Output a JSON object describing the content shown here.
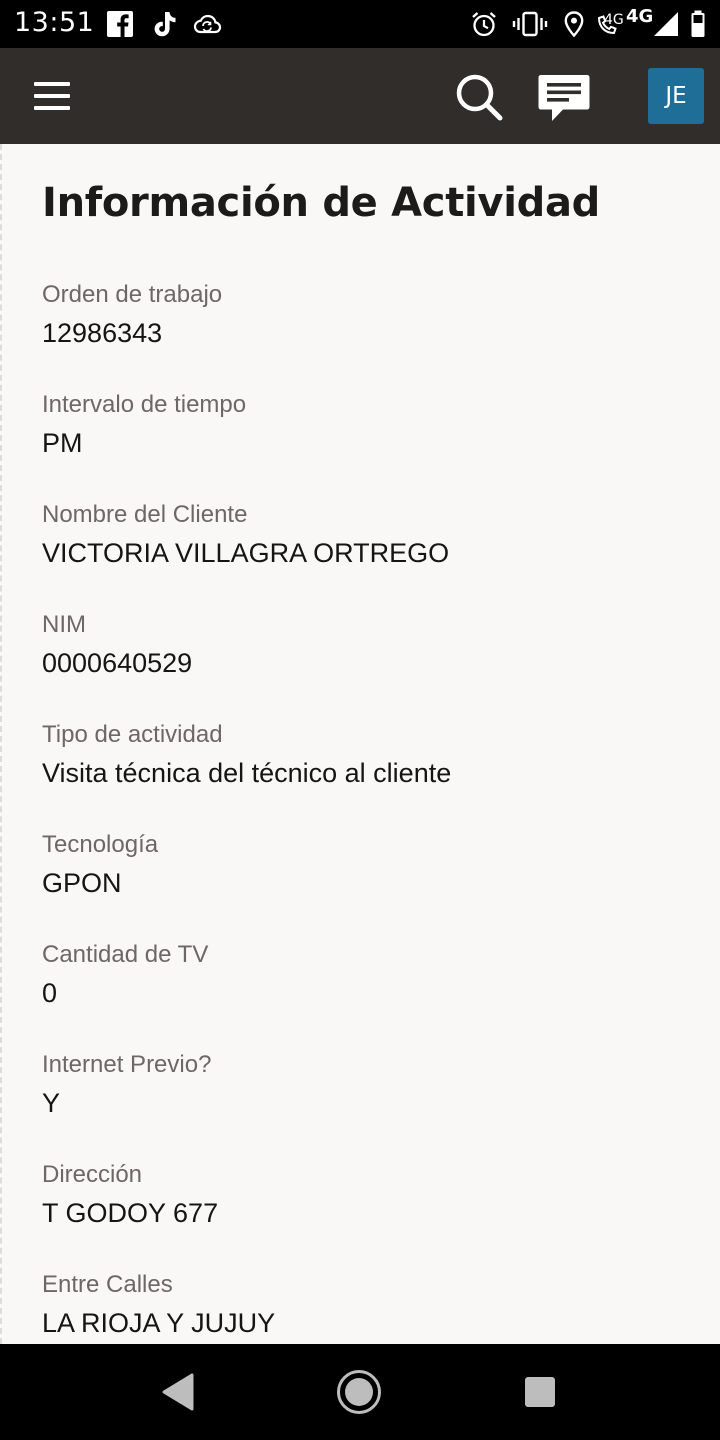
{
  "status_bar": {
    "time": "13:51",
    "network_small": "4G",
    "network_large": "4G",
    "icons": [
      "facebook-icon",
      "tiktok-icon",
      "cloud-sync-icon",
      "alarm-icon",
      "vibrate-icon",
      "location-icon",
      "wifi-calling-icon",
      "signal-icon",
      "battery-icon"
    ]
  },
  "header": {
    "menu_icon": "hamburger-menu-icon",
    "search_icon": "search-icon",
    "chat_icon": "chat-icon",
    "avatar_initials": "JE",
    "avatar_color": "#1e6e97",
    "background_color": "#312d2a"
  },
  "page": {
    "title": "Información de Actividad",
    "fields": [
      {
        "label": "Orden de trabajo",
        "value": "12986343"
      },
      {
        "label": "Intervalo de tiempo",
        "value": "PM"
      },
      {
        "label": "Nombre del Cliente",
        "value": "VICTORIA VILLAGRA ORTREGO"
      },
      {
        "label": "NIM",
        "value": "0000640529"
      },
      {
        "label": "Tipo de actividad",
        "value": "Visita técnica del técnico al cliente"
      },
      {
        "label": "Tecnología",
        "value": "GPON"
      },
      {
        "label": "Cantidad de TV",
        "value": "0"
      },
      {
        "label": "Internet Previo?",
        "value": "Y"
      },
      {
        "label": "Dirección",
        "value": "T GODOY 677"
      },
      {
        "label": "Entre Calles",
        "value": "LA RIOJA Y JUJUY"
      }
    ]
  },
  "nav_bar": {
    "icons": [
      "back-icon",
      "home-icon",
      "recents-icon"
    ]
  }
}
